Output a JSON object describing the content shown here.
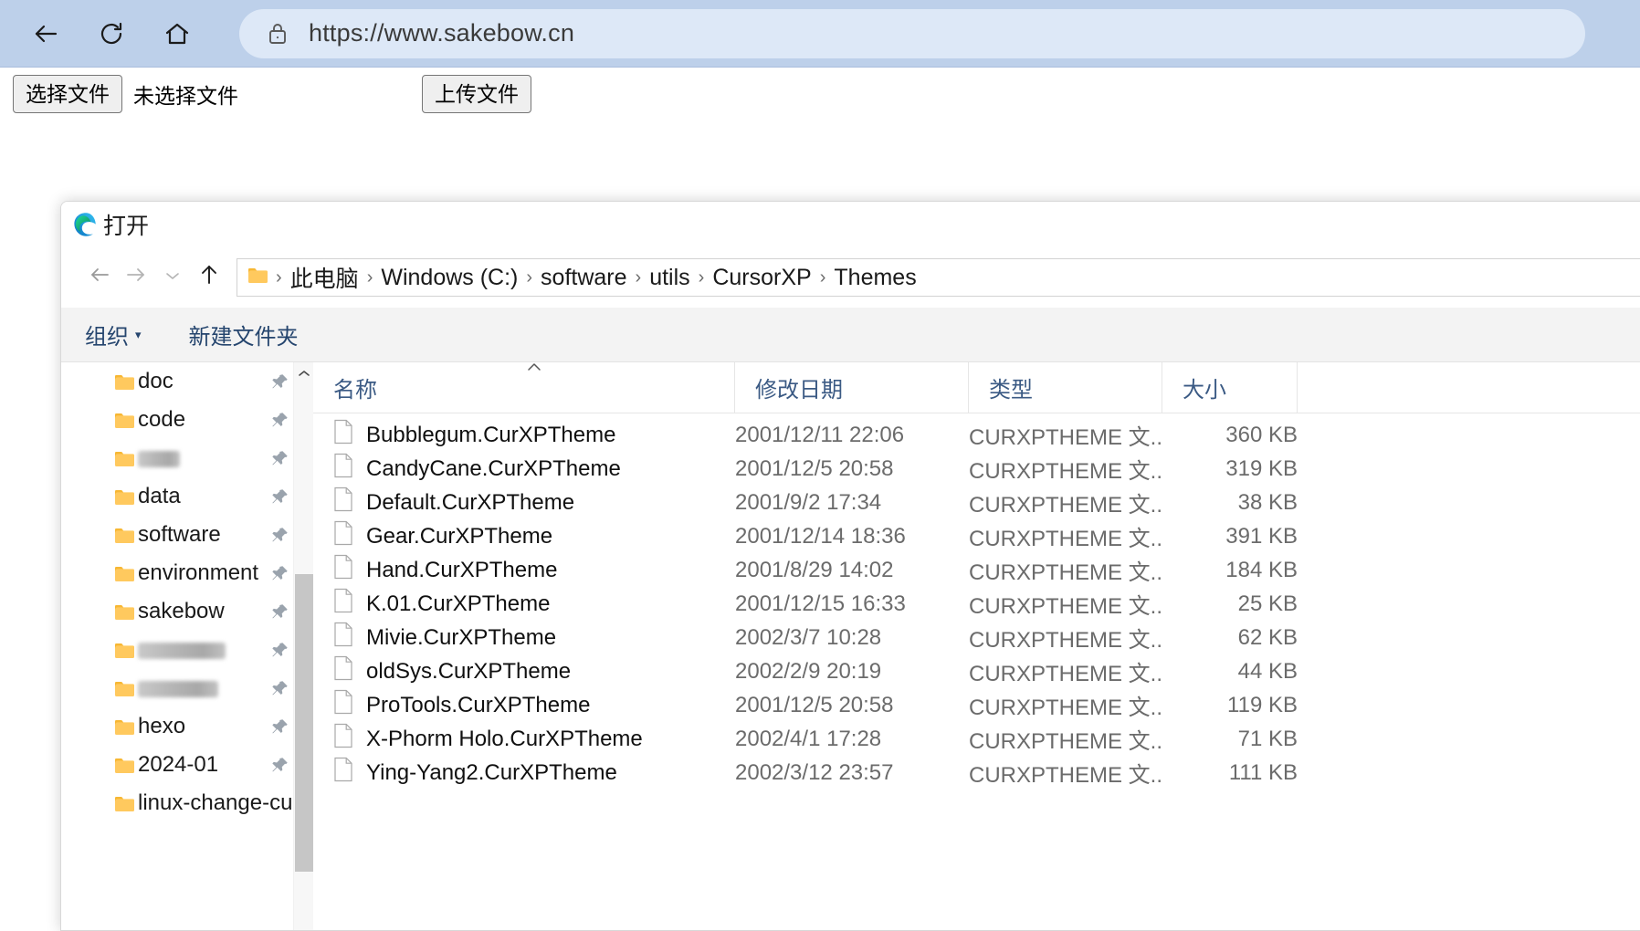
{
  "browser": {
    "back_icon": "back-arrow-icon",
    "reload_icon": "reload-icon",
    "home_icon": "home-icon",
    "lock_icon": "lock-icon",
    "url": "https://www.sakebow.cn"
  },
  "page": {
    "choose_file_button": "选择文件",
    "no_file_label": "未选择文件",
    "upload_button": "上传文件"
  },
  "dialog": {
    "title": "打开",
    "app_icon": "edge-logo-icon",
    "nav": {
      "back_icon": "back-arrow-icon",
      "forward_icon": "forward-arrow-icon",
      "recent_icon": "chevron-down-icon",
      "up_icon": "up-arrow-icon",
      "folder_icon": "folder-icon",
      "separator": "›"
    },
    "breadcrumbs": [
      "此电脑",
      "Windows (C:)",
      "software",
      "utils",
      "CursorXP",
      "Themes"
    ],
    "commandbar": {
      "organize_label": "组织",
      "organize_caret": "▾",
      "new_folder_label": "新建文件夹"
    },
    "columns": {
      "name": "名称",
      "date": "修改日期",
      "type": "类型",
      "size": "大小",
      "sort_caret": "⌃"
    },
    "sidebar": {
      "folder_icon": "folder-icon",
      "pin_icon": "pin-icon",
      "scroll_up_icon": "chevron-up-icon",
      "items": [
        {
          "label": "doc",
          "redacted": false,
          "pinned": true
        },
        {
          "label": "code",
          "redacted": false,
          "pinned": true
        },
        {
          "label": "",
          "redacted": true,
          "redacted_width": 46,
          "pinned": true
        },
        {
          "label": "data",
          "redacted": false,
          "pinned": true
        },
        {
          "label": "software",
          "redacted": false,
          "pinned": true
        },
        {
          "label": "environment",
          "redacted": false,
          "pinned": true
        },
        {
          "label": "sakebow",
          "redacted": false,
          "pinned": true
        },
        {
          "label": "",
          "redacted": true,
          "redacted_width": 96,
          "pinned": true
        },
        {
          "label": "",
          "redacted": true,
          "redacted_width": 88,
          "pinned": true
        },
        {
          "label": "hexo",
          "redacted": false,
          "pinned": true
        },
        {
          "label": "2024-01",
          "redacted": false,
          "pinned": true
        },
        {
          "label": "linux-change-cu",
          "redacted": false,
          "pinned": false
        }
      ]
    },
    "files": [
      {
        "icon": "file-icon",
        "name": "Bubblegum.CurXPTheme",
        "date": "2001/12/11 22:06",
        "type": "CURXPTHEME 文...",
        "size": "360 KB"
      },
      {
        "icon": "file-icon",
        "name": "CandyCane.CurXPTheme",
        "date": "2001/12/5 20:58",
        "type": "CURXPTHEME 文...",
        "size": "319 KB"
      },
      {
        "icon": "file-icon",
        "name": "Default.CurXPTheme",
        "date": "2001/9/2 17:34",
        "type": "CURXPTHEME 文...",
        "size": "38 KB"
      },
      {
        "icon": "file-icon",
        "name": "Gear.CurXPTheme",
        "date": "2001/12/14 18:36",
        "type": "CURXPTHEME 文...",
        "size": "391 KB"
      },
      {
        "icon": "file-icon",
        "name": "Hand.CurXPTheme",
        "date": "2001/8/29 14:02",
        "type": "CURXPTHEME 文...",
        "size": "184 KB"
      },
      {
        "icon": "file-icon",
        "name": "K.01.CurXPTheme",
        "date": "2001/12/15 16:33",
        "type": "CURXPTHEME 文...",
        "size": "25 KB"
      },
      {
        "icon": "file-icon",
        "name": "Mivie.CurXPTheme",
        "date": "2002/3/7 10:28",
        "type": "CURXPTHEME 文...",
        "size": "62 KB"
      },
      {
        "icon": "file-icon",
        "name": "oldSys.CurXPTheme",
        "date": "2002/2/9 20:19",
        "type": "CURXPTHEME 文...",
        "size": "44 KB"
      },
      {
        "icon": "file-icon",
        "name": "ProTools.CurXPTheme",
        "date": "2001/12/5 20:58",
        "type": "CURXPTHEME 文...",
        "size": "119 KB"
      },
      {
        "icon": "file-icon",
        "name": "X-Phorm Holo.CurXPTheme",
        "date": "2002/4/1 17:28",
        "type": "CURXPTHEME 文...",
        "size": "71 KB"
      },
      {
        "icon": "file-icon",
        "name": "Ying-Yang2.CurXPTheme",
        "date": "2002/3/12 23:57",
        "type": "CURXPTHEME 文...",
        "size": "111 KB"
      }
    ]
  },
  "colors": {
    "browser_chrome": "#bdd0ea",
    "address_field": "#dde8f7",
    "command_bar": "#f3f3f3",
    "column_header_text": "#3b5a84",
    "folder_yellow": "#ffc95e",
    "scrollbar_thumb": "#c6c6c6"
  }
}
